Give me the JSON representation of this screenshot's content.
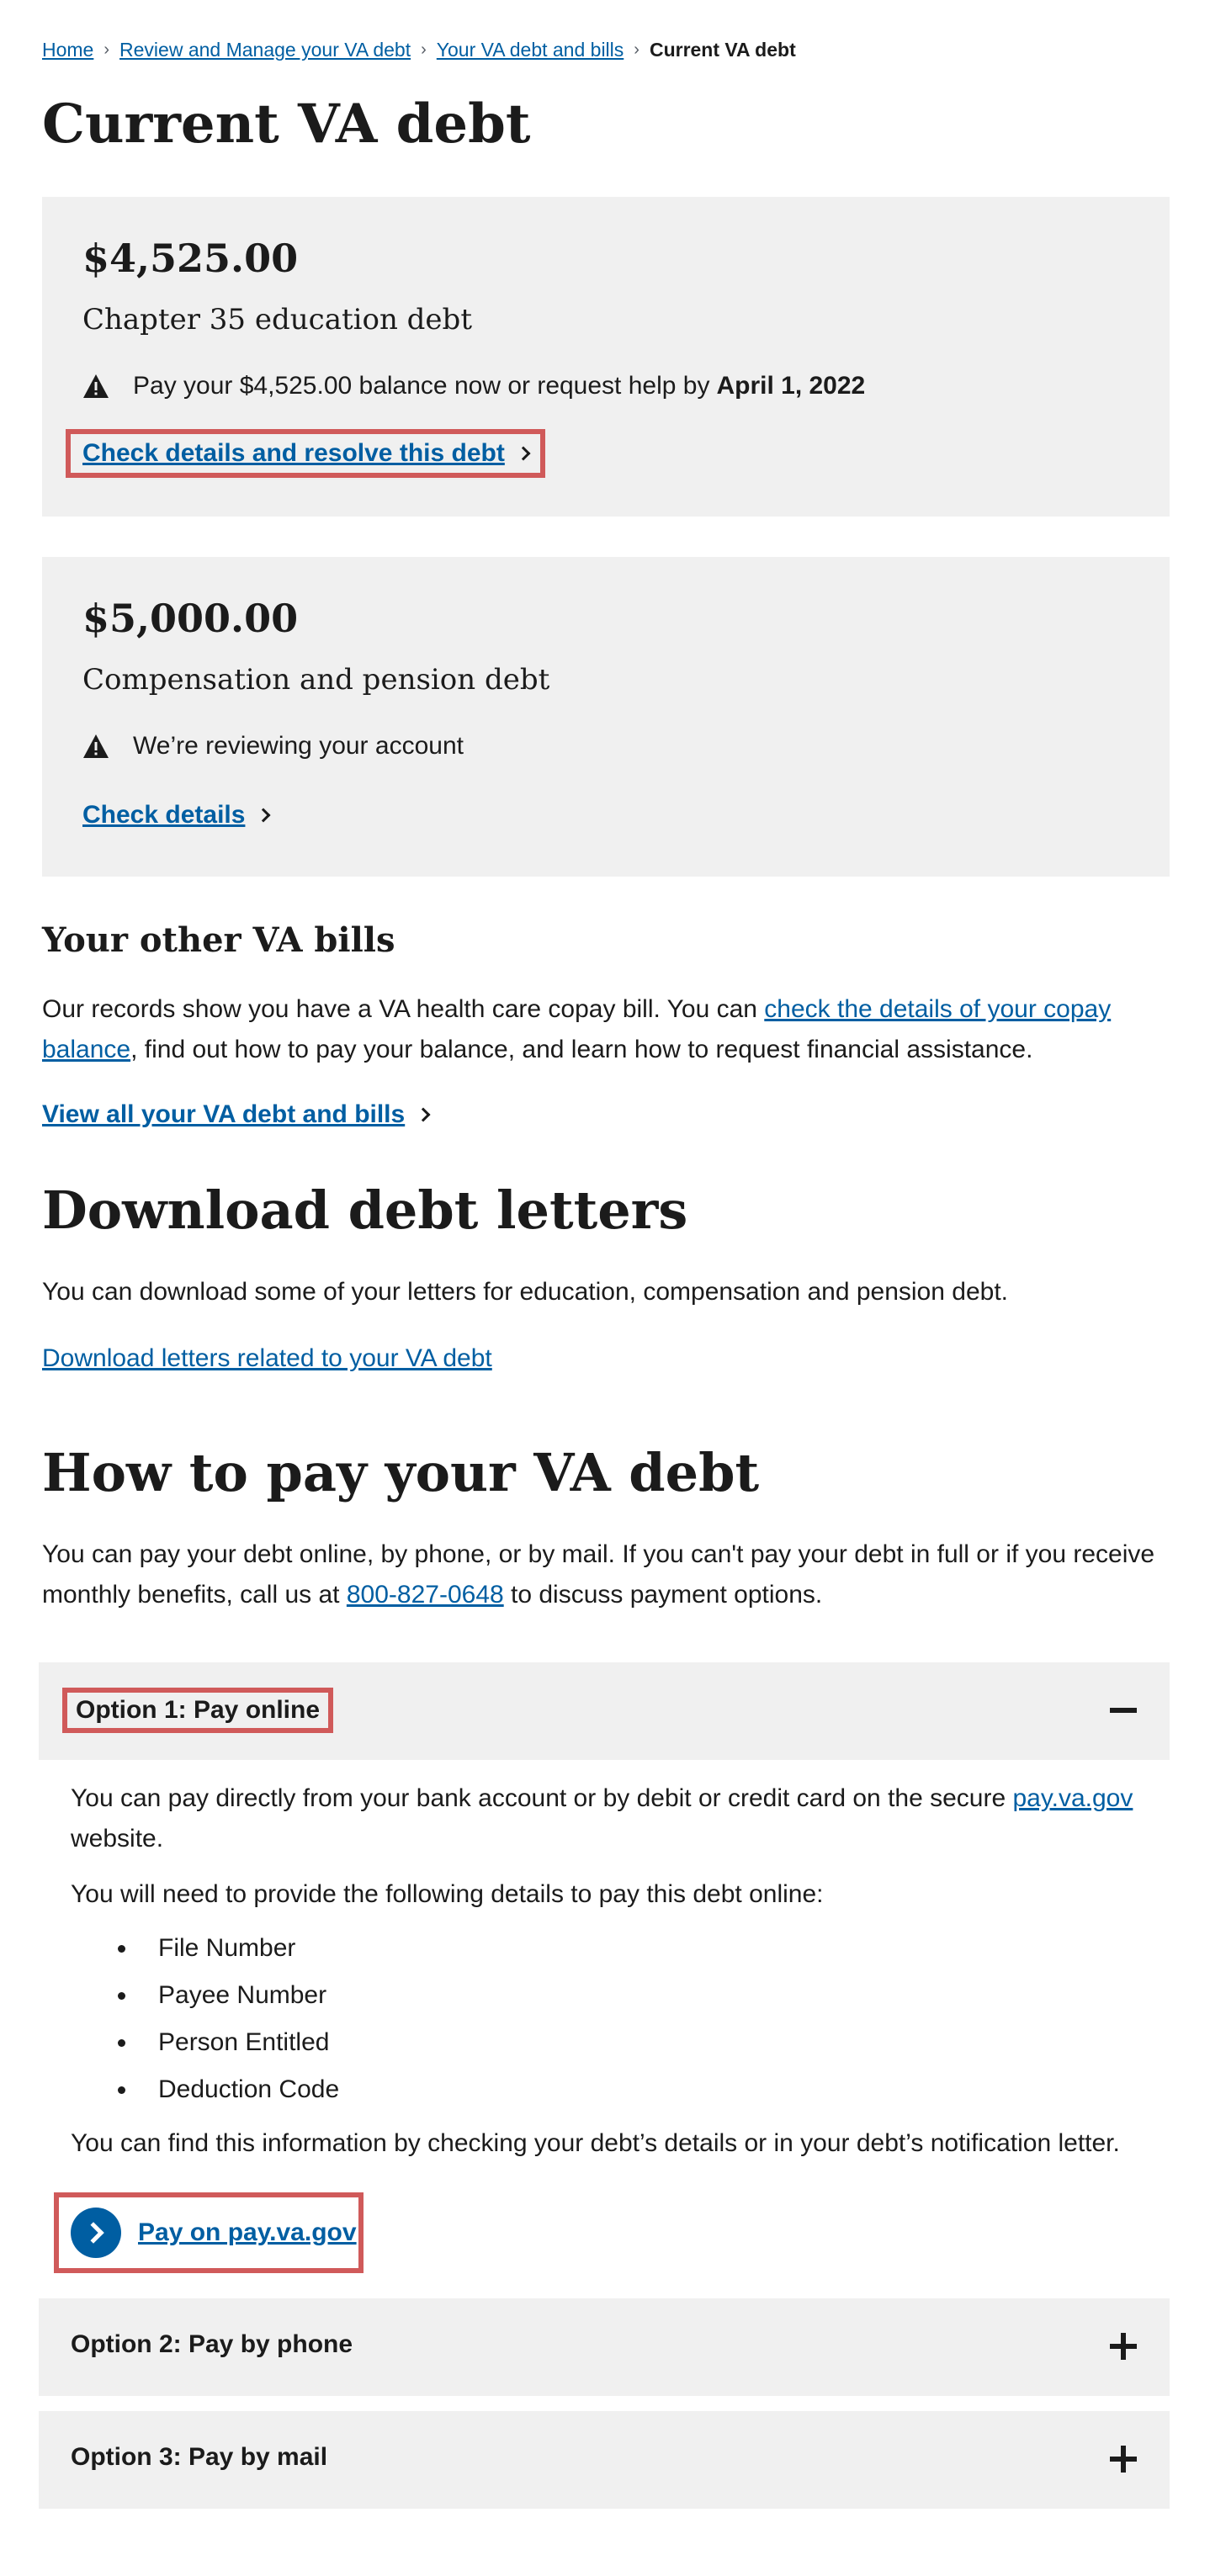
{
  "breadcrumb": {
    "items": [
      "Home",
      "Review and Manage your VA debt",
      "Your VA debt and bills"
    ],
    "current": "Current VA debt"
  },
  "page_title": "Current VA debt",
  "debts": [
    {
      "amount": "$4,525.00",
      "label": "Chapter 35 education debt",
      "status": "Pay your $4,525.00 balance now or request help by",
      "status_date": "April 1, 2022",
      "cta": "Check details and resolve this debt"
    },
    {
      "amount": "$5,000.00",
      "label": "Compensation and pension debt",
      "status": "We’re reviewing your account",
      "cta": "Check details"
    }
  ],
  "other_bills": {
    "heading": "Your other VA bills",
    "text_before": "Our records show you have a VA health care copay bill. You can ",
    "link": "check the details of your copay balance",
    "text_after": ", find out how to pay your balance, and learn how to request financial assistance.",
    "view_all": "View all your VA debt and bills"
  },
  "letters": {
    "heading": "Download debt letters",
    "text": "You can download some of your letters for education, compensation and pension debt.",
    "link": "Download letters related to your VA debt"
  },
  "how_to_pay": {
    "heading": "How to pay your VA debt",
    "text_before": "You can pay your debt online, by phone, or by mail. If you can't pay your debt in full or if you receive monthly benefits, call us at ",
    "phone": "800-827-0648",
    "text_after": " to discuss payment options."
  },
  "options": [
    {
      "title": "Option 1: Pay online",
      "expanded": true,
      "intro_before": "You can pay directly from your bank account or by debit or credit card on the secure ",
      "intro_link": "pay.va.gov",
      "intro_after": " website.",
      "details_intro": "You will need to provide the following details to pay this debt online:",
      "details": [
        "File Number",
        "Payee Number",
        "Person Entitled",
        "Deduction Code"
      ],
      "find_info": "You can find this information by checking your debt’s details or in your debt’s notification letter.",
      "button": "Pay on pay.va.gov"
    },
    {
      "title": "Option 2: Pay by phone",
      "expanded": false
    },
    {
      "title": "Option 3: Pay by mail",
      "expanded": false
    }
  ],
  "colors": {
    "link": "#005ea2",
    "card_bg": "#f0f0f0",
    "highlight": "#d05a5a",
    "text": "#1b1b1b"
  },
  "icons": {
    "warning": "warning-triangle-icon",
    "minus": "minus-icon",
    "plus": "plus-icon",
    "chevron": "chevron-right-icon"
  }
}
